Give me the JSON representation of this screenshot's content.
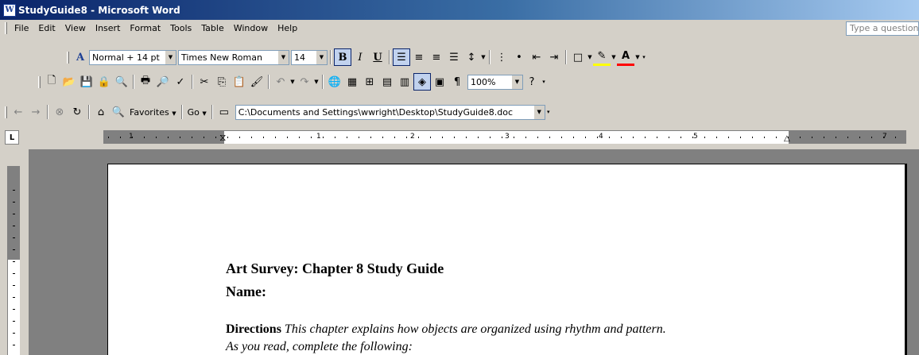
{
  "window": {
    "title": "StudyGuide8 - Microsoft Word"
  },
  "menu": {
    "items": [
      "File",
      "Edit",
      "View",
      "Insert",
      "Format",
      "Tools",
      "Table",
      "Window",
      "Help"
    ],
    "ask_placeholder": "Type a question"
  },
  "formatting": {
    "style": "Normal + 14 pt",
    "font": "Times New Roman",
    "size": "14",
    "bold_label": "B",
    "italic_label": "I",
    "underline_label": "U"
  },
  "standard": {
    "zoom": "100%",
    "pilcrow": "¶"
  },
  "web": {
    "favorites_label": "Favorites",
    "go_label": "Go",
    "address": "C:\\Documents and Settings\\wwright\\Desktop\\StudyGuide8.doc"
  },
  "ruler": {
    "corner": "L",
    "numbers": [
      "1",
      "1",
      "2",
      "3",
      "4",
      "5",
      "7"
    ]
  },
  "document": {
    "title": "Art Survey: Chapter 8 Study Guide",
    "name_line": "Name:",
    "directions_label": "Directions",
    "directions_text_1": "This chapter explains how objects are organized using rhythm and pattern.",
    "directions_text_2": "As you read, complete the following:"
  },
  "colors": {
    "titlebar": "#0A246A",
    "chrome": "#D4D0C8",
    "workspace": "#808080",
    "highlight": "#FFFF00",
    "font_color": "#FF0000"
  }
}
